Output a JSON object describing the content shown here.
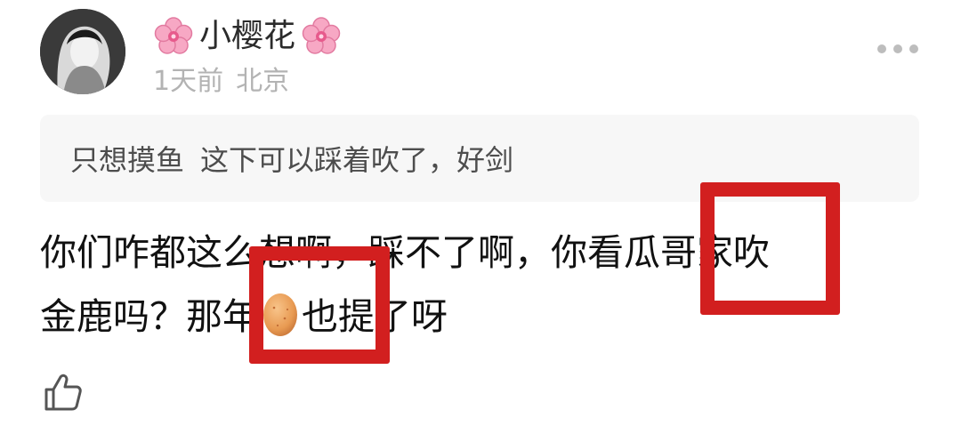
{
  "post": {
    "username": "小樱花",
    "time_ago": "1天前",
    "location": "北京"
  },
  "quote": {
    "user": "只想摸鱼",
    "text": "这下可以踩着吹了，好剑"
  },
  "comment": {
    "line1": "你们咋都这么想啊，踩不了啊，你看瓜哥家吹",
    "line2_a": "金鹿吗？那年",
    "line2_b": "也提了呀"
  },
  "icons": {
    "flower": "cherry-blossom-icon",
    "egg": "egg-emoji",
    "like": "thumbs-up-icon",
    "more": "more-dots-icon"
  },
  "colors": {
    "highlight": "#d21f1f",
    "quote_bg": "#f7f7f7",
    "meta_text": "#b3b3b3"
  }
}
